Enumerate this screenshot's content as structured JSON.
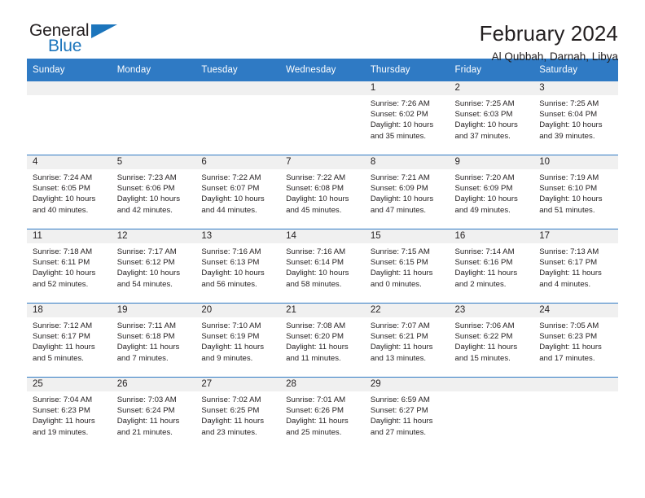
{
  "brand": {
    "name_top": "General",
    "name_bottom": "Blue",
    "accent_color": "#1c75bc",
    "logo_icon": "triangle-logo-icon"
  },
  "header": {
    "title": "February 2024",
    "subtitle": "Al Qubbah, Darnah, Libya"
  },
  "calendar": {
    "header_bg": "#2f7ac4",
    "daynum_bg": "#f0f0f0",
    "weekday_labels": [
      "Sunday",
      "Monday",
      "Tuesday",
      "Wednesday",
      "Thursday",
      "Friday",
      "Saturday"
    ],
    "weeks": [
      [
        {
          "day": "",
          "lines": []
        },
        {
          "day": "",
          "lines": []
        },
        {
          "day": "",
          "lines": []
        },
        {
          "day": "",
          "lines": []
        },
        {
          "day": "1",
          "lines": [
            "Sunrise: 7:26 AM",
            "Sunset: 6:02 PM",
            "Daylight: 10 hours",
            "and 35 minutes."
          ]
        },
        {
          "day": "2",
          "lines": [
            "Sunrise: 7:25 AM",
            "Sunset: 6:03 PM",
            "Daylight: 10 hours",
            "and 37 minutes."
          ]
        },
        {
          "day": "3",
          "lines": [
            "Sunrise: 7:25 AM",
            "Sunset: 6:04 PM",
            "Daylight: 10 hours",
            "and 39 minutes."
          ]
        }
      ],
      [
        {
          "day": "4",
          "lines": [
            "Sunrise: 7:24 AM",
            "Sunset: 6:05 PM",
            "Daylight: 10 hours",
            "and 40 minutes."
          ]
        },
        {
          "day": "5",
          "lines": [
            "Sunrise: 7:23 AM",
            "Sunset: 6:06 PM",
            "Daylight: 10 hours",
            "and 42 minutes."
          ]
        },
        {
          "day": "6",
          "lines": [
            "Sunrise: 7:22 AM",
            "Sunset: 6:07 PM",
            "Daylight: 10 hours",
            "and 44 minutes."
          ]
        },
        {
          "day": "7",
          "lines": [
            "Sunrise: 7:22 AM",
            "Sunset: 6:08 PM",
            "Daylight: 10 hours",
            "and 45 minutes."
          ]
        },
        {
          "day": "8",
          "lines": [
            "Sunrise: 7:21 AM",
            "Sunset: 6:09 PM",
            "Daylight: 10 hours",
            "and 47 minutes."
          ]
        },
        {
          "day": "9",
          "lines": [
            "Sunrise: 7:20 AM",
            "Sunset: 6:09 PM",
            "Daylight: 10 hours",
            "and 49 minutes."
          ]
        },
        {
          "day": "10",
          "lines": [
            "Sunrise: 7:19 AM",
            "Sunset: 6:10 PM",
            "Daylight: 10 hours",
            "and 51 minutes."
          ]
        }
      ],
      [
        {
          "day": "11",
          "lines": [
            "Sunrise: 7:18 AM",
            "Sunset: 6:11 PM",
            "Daylight: 10 hours",
            "and 52 minutes."
          ]
        },
        {
          "day": "12",
          "lines": [
            "Sunrise: 7:17 AM",
            "Sunset: 6:12 PM",
            "Daylight: 10 hours",
            "and 54 minutes."
          ]
        },
        {
          "day": "13",
          "lines": [
            "Sunrise: 7:16 AM",
            "Sunset: 6:13 PM",
            "Daylight: 10 hours",
            "and 56 minutes."
          ]
        },
        {
          "day": "14",
          "lines": [
            "Sunrise: 7:16 AM",
            "Sunset: 6:14 PM",
            "Daylight: 10 hours",
            "and 58 minutes."
          ]
        },
        {
          "day": "15",
          "lines": [
            "Sunrise: 7:15 AM",
            "Sunset: 6:15 PM",
            "Daylight: 11 hours",
            "and 0 minutes."
          ]
        },
        {
          "day": "16",
          "lines": [
            "Sunrise: 7:14 AM",
            "Sunset: 6:16 PM",
            "Daylight: 11 hours",
            "and 2 minutes."
          ]
        },
        {
          "day": "17",
          "lines": [
            "Sunrise: 7:13 AM",
            "Sunset: 6:17 PM",
            "Daylight: 11 hours",
            "and 4 minutes."
          ]
        }
      ],
      [
        {
          "day": "18",
          "lines": [
            "Sunrise: 7:12 AM",
            "Sunset: 6:17 PM",
            "Daylight: 11 hours",
            "and 5 minutes."
          ]
        },
        {
          "day": "19",
          "lines": [
            "Sunrise: 7:11 AM",
            "Sunset: 6:18 PM",
            "Daylight: 11 hours",
            "and 7 minutes."
          ]
        },
        {
          "day": "20",
          "lines": [
            "Sunrise: 7:10 AM",
            "Sunset: 6:19 PM",
            "Daylight: 11 hours",
            "and 9 minutes."
          ]
        },
        {
          "day": "21",
          "lines": [
            "Sunrise: 7:08 AM",
            "Sunset: 6:20 PM",
            "Daylight: 11 hours",
            "and 11 minutes."
          ]
        },
        {
          "day": "22",
          "lines": [
            "Sunrise: 7:07 AM",
            "Sunset: 6:21 PM",
            "Daylight: 11 hours",
            "and 13 minutes."
          ]
        },
        {
          "day": "23",
          "lines": [
            "Sunrise: 7:06 AM",
            "Sunset: 6:22 PM",
            "Daylight: 11 hours",
            "and 15 minutes."
          ]
        },
        {
          "day": "24",
          "lines": [
            "Sunrise: 7:05 AM",
            "Sunset: 6:23 PM",
            "Daylight: 11 hours",
            "and 17 minutes."
          ]
        }
      ],
      [
        {
          "day": "25",
          "lines": [
            "Sunrise: 7:04 AM",
            "Sunset: 6:23 PM",
            "Daylight: 11 hours",
            "and 19 minutes."
          ]
        },
        {
          "day": "26",
          "lines": [
            "Sunrise: 7:03 AM",
            "Sunset: 6:24 PM",
            "Daylight: 11 hours",
            "and 21 minutes."
          ]
        },
        {
          "day": "27",
          "lines": [
            "Sunrise: 7:02 AM",
            "Sunset: 6:25 PM",
            "Daylight: 11 hours",
            "and 23 minutes."
          ]
        },
        {
          "day": "28",
          "lines": [
            "Sunrise: 7:01 AM",
            "Sunset: 6:26 PM",
            "Daylight: 11 hours",
            "and 25 minutes."
          ]
        },
        {
          "day": "29",
          "lines": [
            "Sunrise: 6:59 AM",
            "Sunset: 6:27 PM",
            "Daylight: 11 hours",
            "and 27 minutes."
          ]
        },
        {
          "day": "",
          "lines": []
        },
        {
          "day": "",
          "lines": []
        }
      ]
    ]
  }
}
